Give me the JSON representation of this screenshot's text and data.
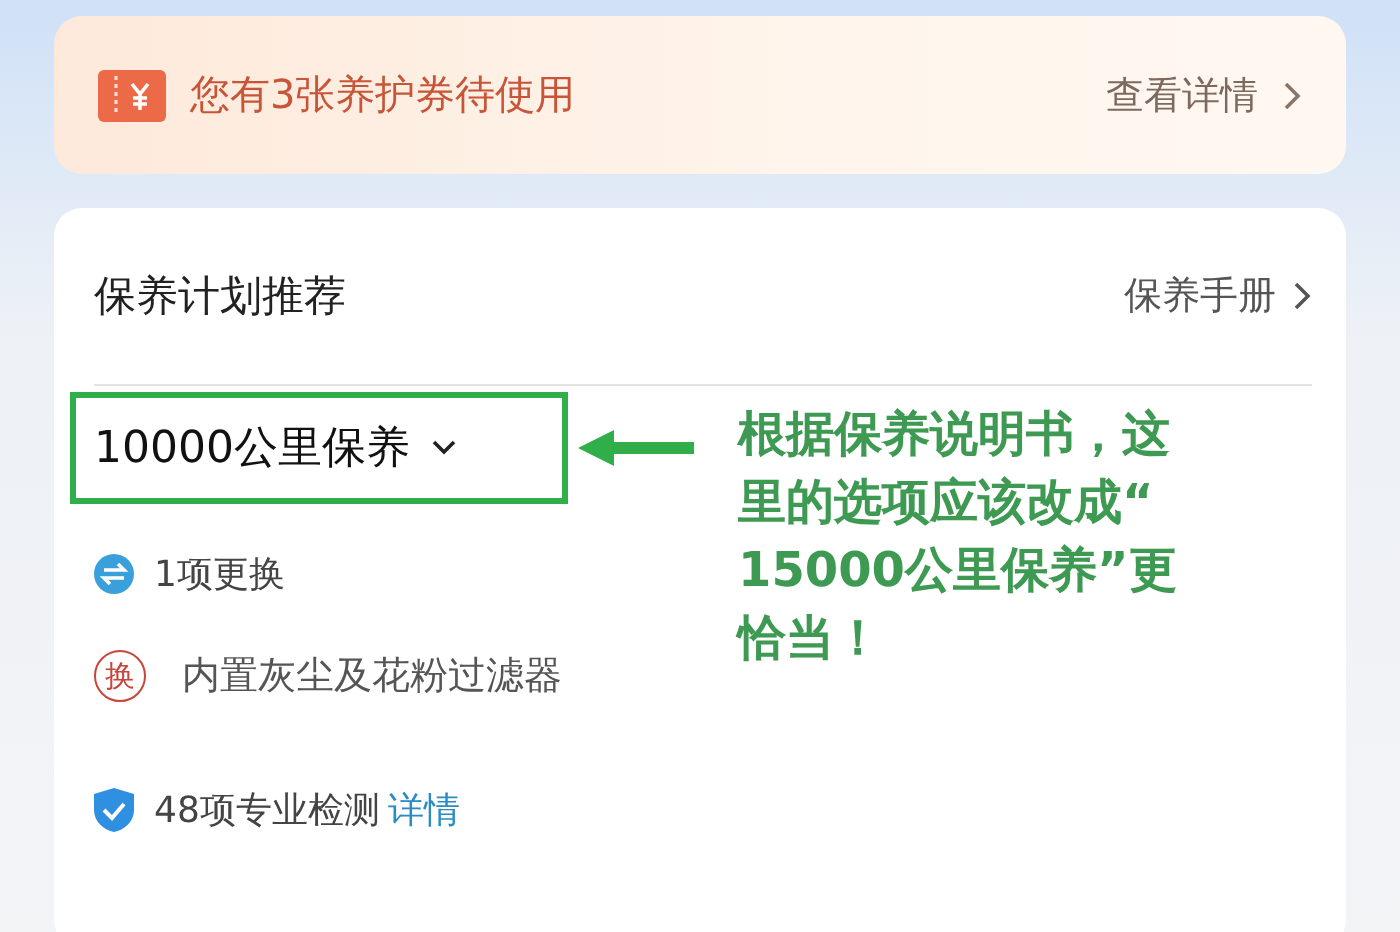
{
  "coupon_banner": {
    "text": "您有3张养护券待使用",
    "link": "查看详情"
  },
  "maintenance_plan": {
    "title": "保养计划推荐",
    "manual_link": "保养手册",
    "selector": "10000公里保养",
    "replacement": {
      "count": "1项更换",
      "badge": "换",
      "items": [
        "内置灰尘及花粉过滤器"
      ]
    },
    "inspection": {
      "text": "48项专业检测",
      "link": "详情"
    }
  },
  "annotation": {
    "text": "根据保养说明书，这里的选项应该改成“15000公里保养”更恰当！"
  }
}
